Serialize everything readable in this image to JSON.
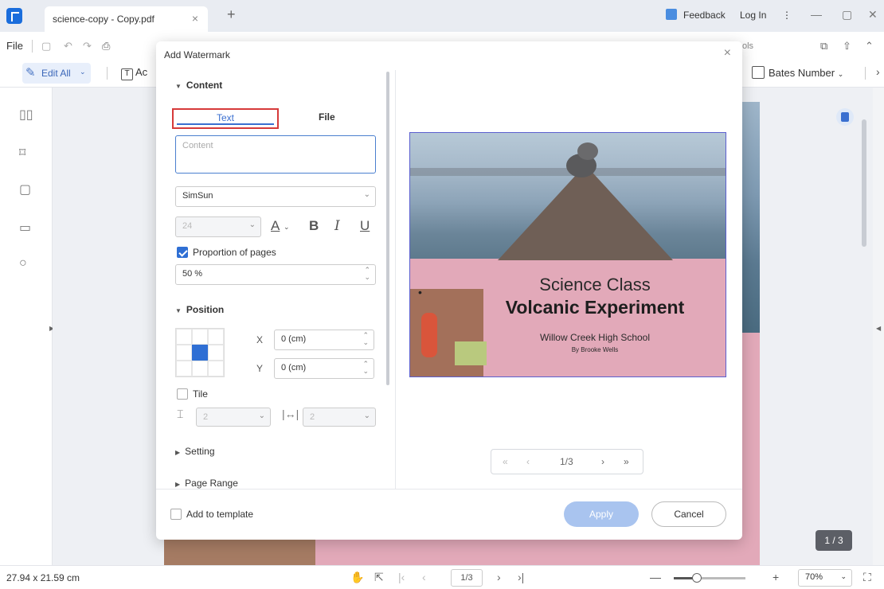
{
  "window": {
    "tab_title": "science-copy - Copy.pdf",
    "tab_close": "×",
    "tab_add": "+",
    "feedback": "Feedback",
    "login": "Log In",
    "more": "⋮",
    "minimize": "—",
    "maximize": "▢",
    "close": "✕"
  },
  "menu": {
    "file": "File",
    "tools_partial": "ols"
  },
  "toolbar": {
    "edit_all": "Edit All",
    "add_text_partial": "Ac",
    "add_text_icon": "T",
    "bates": "Bates Number",
    "more_arrow": "›"
  },
  "sidebar": {
    "icons": [
      "thumbnails-icon",
      "bookmark-icon",
      "comment-icon",
      "attachment-icon",
      "search-icon"
    ]
  },
  "canvas": {
    "page_badge": "1 / 3"
  },
  "status": {
    "page_size": "27.94 x 21.59 cm",
    "page_field": "1/3",
    "zoom": "70%",
    "zoom_level_fraction": 0.32
  },
  "dialog": {
    "title": "Add Watermark",
    "close": "×",
    "content_section": "Content",
    "tab_text": "Text",
    "tab_file": "File",
    "content_placeholder": "Content",
    "font_name": "SimSun",
    "font_size": "24",
    "format_buttons": {
      "color": "A",
      "bold": "B",
      "italic": "I",
      "underline": "U"
    },
    "proportion_label": "Proportion of pages",
    "proportion_checked": true,
    "proportion_value": "50 %",
    "position_section": "Position",
    "x_label": "X",
    "x_value": "0 (cm)",
    "y_label": "Y",
    "y_value": "0 (cm)",
    "tile_label": "Tile",
    "tile_checked": false,
    "tile_spacing_v": "2",
    "tile_spacing_h": "2",
    "setting_section": "Setting",
    "page_range_section": "Page Range",
    "add_template_label": "Add to template",
    "apply": "Apply",
    "cancel": "Cancel",
    "preview": {
      "line1": "Science Class",
      "line2": "Volcanic Experiment",
      "line3": "Willow Creek High School",
      "line4": "By Brooke Wells",
      "pager_first": "«",
      "pager_prev": "‹",
      "pager_value": "1/3",
      "pager_next": "›",
      "pager_last": "»"
    }
  },
  "colors": {
    "accent": "#2f6fd4",
    "tab_highlight": "#d63a3a",
    "page_pink": "#e2a9b9"
  }
}
